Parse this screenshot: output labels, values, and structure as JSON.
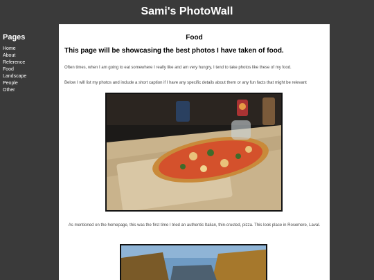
{
  "site": {
    "title": "Sami's PhotoWall"
  },
  "sidebar": {
    "heading": "Pages",
    "items": [
      {
        "label": "Home"
      },
      {
        "label": "About"
      },
      {
        "label": "Reference"
      },
      {
        "label": "Food"
      },
      {
        "label": "Landscape"
      },
      {
        "label": "People"
      },
      {
        "label": "Other"
      }
    ]
  },
  "main": {
    "heading": "Food",
    "intro": "This page will be showcasing the best photos I have taken of food.",
    "paragraph1": "Often times, when I am going to eat somewhere I really like and am very hungry, I tend to take photos like these of my food.",
    "paragraph2": "Below I will list my photos and include a short caption if I have any specific details about them or any fun facts that might be relevant",
    "photo1_caption": "As mentioned on the homepage, this was the first time I tried an authentic Italian, thin-crusted, pizza. This look place in Rosemere, Laval."
  },
  "colors": {
    "background": "#3a3a3a",
    "content": "#ffffff",
    "title": "#ffffff"
  }
}
